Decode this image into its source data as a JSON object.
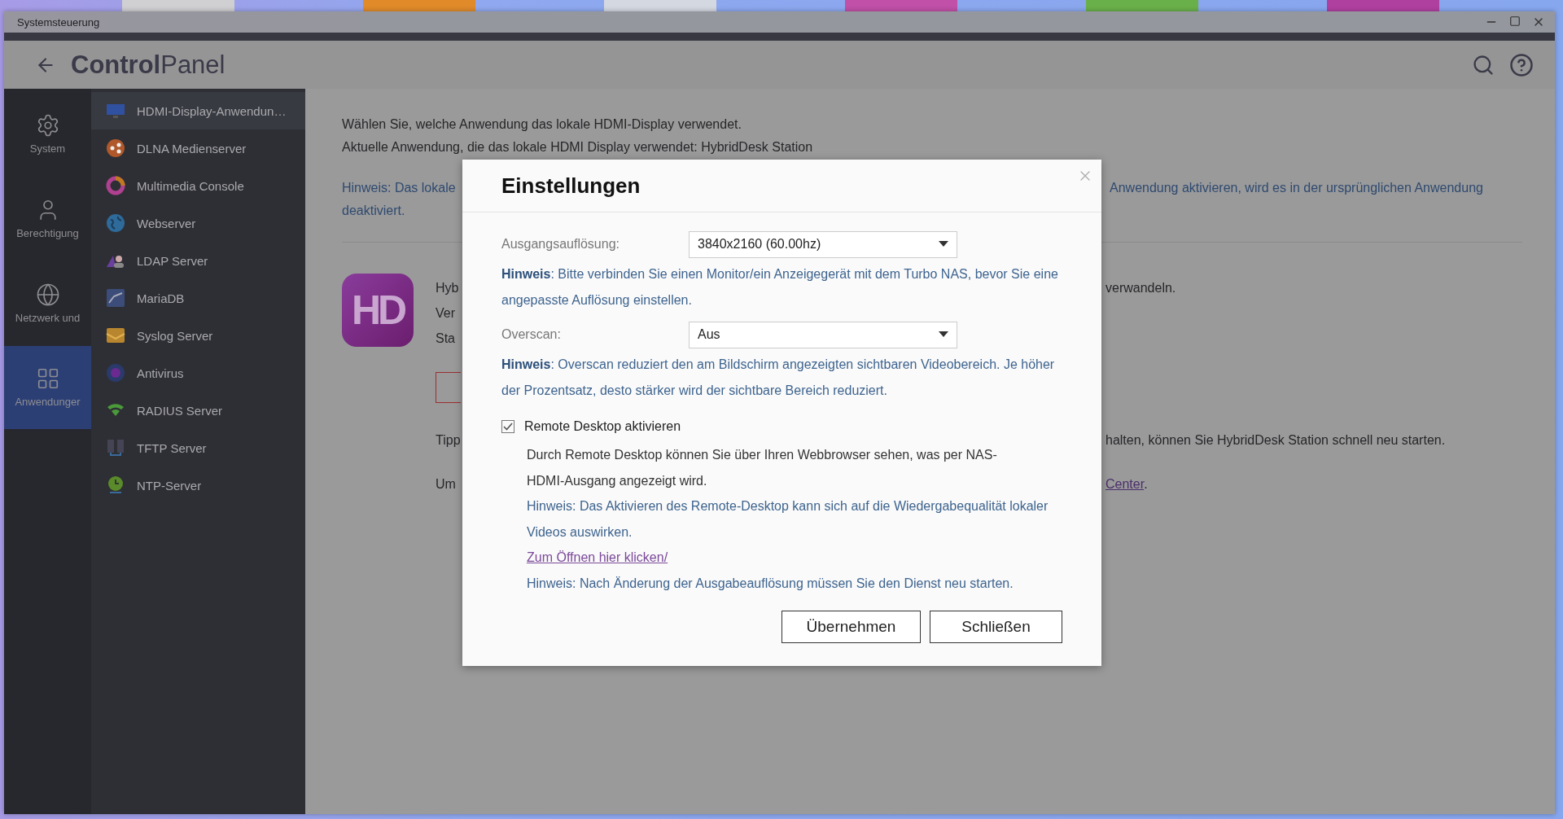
{
  "window": {
    "title": "Systemsteuerung"
  },
  "header": {
    "title_bold": "Control",
    "title_light": "Panel"
  },
  "nav_rail": [
    {
      "label": "System",
      "selected": false
    },
    {
      "label": "Berechtigung",
      "selected": false
    },
    {
      "label": "Netzwerk und",
      "selected": false
    },
    {
      "label": "Anwendunger",
      "selected": true
    }
  ],
  "apps": [
    {
      "label": "HDMI-Display-Anwendun…",
      "selected": true
    },
    {
      "label": "DLNA Medienserver",
      "selected": false
    },
    {
      "label": "Multimedia Console",
      "selected": false
    },
    {
      "label": "Webserver",
      "selected": false
    },
    {
      "label": "LDAP Server",
      "selected": false
    },
    {
      "label": "MariaDB",
      "selected": false
    },
    {
      "label": "Syslog Server",
      "selected": false
    },
    {
      "label": "Antivirus",
      "selected": false
    },
    {
      "label": "RADIUS Server",
      "selected": false
    },
    {
      "label": "TFTP Server",
      "selected": false
    },
    {
      "label": "NTP-Server",
      "selected": false
    }
  ],
  "content": {
    "intro": "Wählen Sie, welche Anwendung das lokale HDMI-Display verwendet.",
    "current": "Aktuelle Anwendung, die das lokale HDMI Display verwendet: HybridDesk Station",
    "note_left": "Hinweis: Das lokale",
    "note_right": "Anwendung aktivieren, wird es in der ursprünglichen Anwendung",
    "note_end": "deaktiviert.",
    "logo_text": "HD",
    "app_lines": [
      {
        "left": "Hyb",
        "right": "verwandeln."
      },
      {
        "left": "Ver"
      },
      {
        "left": "Sta"
      }
    ],
    "tip_left": "Tipp",
    "tip_right": "halten, können Sie HybridDesk Station schnell neu starten.",
    "more_left": "Um",
    "more_link": "Center",
    "more_tail": "."
  },
  "dialog": {
    "title": "Einstellungen",
    "fields": [
      {
        "label": "Ausgangsauflösung:",
        "value": "3840x2160 (60.00hz)",
        "hint": "**Hinweis**: Bitte verbinden Sie einen Monitor/ein Anzeigegerät mit dem Turbo NAS, bevor Sie eine angepasste Auflösung einstellen."
      },
      {
        "label": "Overscan:",
        "value": "Aus",
        "hint": "**Hinweis**: Overscan reduziert den am Bildschirm angezeigten sichtbaren Videobereich. Je höher der Prozentsatz, desto stärker wird der sichtbare Bereich reduziert."
      }
    ],
    "remote": {
      "label": "Remote Desktop aktivieren",
      "checked": true,
      "description": "Durch Remote Desktop können Sie über Ihren Webbrowser sehen, was per NAS-HDMI-Ausgang angezeigt wird.",
      "note": "Hinweis: Das Aktivieren des Remote-Desktop kann sich auf die Wiedergabequalität lokaler Videos auswirken.",
      "link": "Zum Öffnen hier klicken/",
      "restart_note": "Hinweis: Nach Änderung der Ausgabeauflösung müssen Sie den Dienst neu starten."
    },
    "buttons": [
      "Übernehmen",
      "Schließen"
    ]
  }
}
